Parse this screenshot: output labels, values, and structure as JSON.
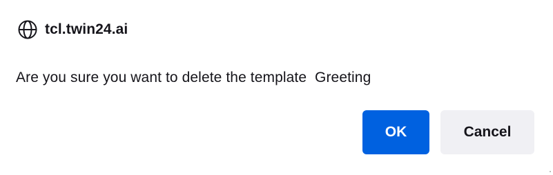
{
  "dialog": {
    "origin": "tcl.twin24.ai",
    "origin_icon": "globe-icon",
    "message": "Are you sure you want to delete the template  Greeting",
    "ok_label": "OK",
    "cancel_label": "Cancel"
  },
  "colors": {
    "primary": "#0061e0",
    "secondary": "#f0f0f4",
    "text": "#15141a",
    "background": "#ffffff"
  }
}
